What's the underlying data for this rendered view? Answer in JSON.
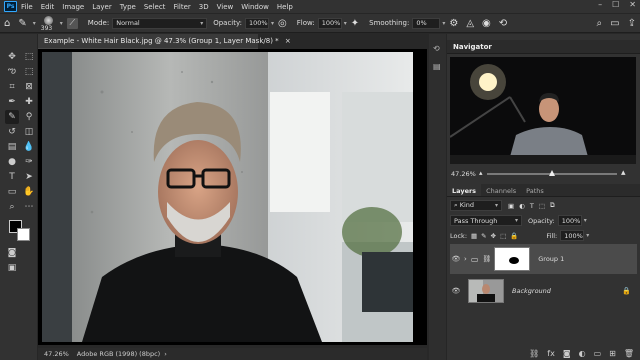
{
  "app": {
    "menu": [
      "File",
      "Edit",
      "Image",
      "Layer",
      "Type",
      "Select",
      "Filter",
      "3D",
      "View",
      "Window",
      "Help"
    ],
    "logo": "Ps",
    "window_controls": [
      "–",
      "☐",
      "✕"
    ]
  },
  "options": {
    "brush_size": "393",
    "mode_label": "Mode:",
    "mode_value": "Normal",
    "opacity_label": "Opacity:",
    "opacity_value": "100%",
    "flow_label": "Flow:",
    "flow_value": "100%",
    "smoothing_label": "Smoothing:",
    "smoothing_value": "0%"
  },
  "document": {
    "tab_title": "Example - White Hair Black.jpg @ 47.3% (Group 1, Layer Mask/8) *",
    "close_glyph": "×",
    "status_zoom": "47.26%",
    "status_profile": "Adobe RGB (1998) (8bpc)"
  },
  "navigator": {
    "title": "Navigator",
    "zoom": "47.26%"
  },
  "layers": {
    "tabs": [
      "Layers",
      "Channels",
      "Paths"
    ],
    "kind_value": "Kind",
    "blend_mode": "Pass Through",
    "opacity_label": "Opacity:",
    "opacity_value": "100%",
    "lock_label": "Lock:",
    "fill_label": "Fill:",
    "fill_value": "100%",
    "items": [
      {
        "name": "Group 1",
        "selected": true
      },
      {
        "name": "Background",
        "selected": false
      }
    ]
  },
  "colors": {
    "accent": "#31a8ff",
    "foreground": "#000000",
    "background": "#ffffff"
  },
  "icons": {
    "home": "home-icon",
    "brush": "brush-icon",
    "search": "search-icon",
    "share": "share-icon"
  }
}
